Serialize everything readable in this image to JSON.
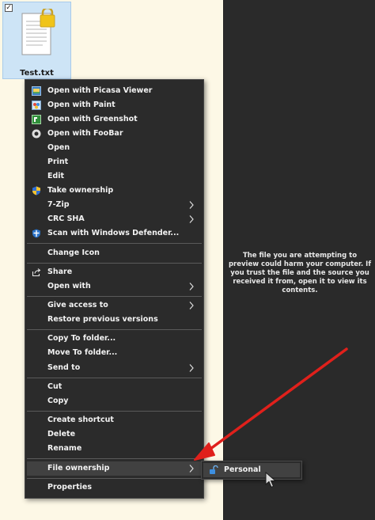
{
  "file": {
    "name": "Test.txt",
    "checked": true,
    "icon": "locked-text-file-icon"
  },
  "context_menu": {
    "items": [
      {
        "label": "Open with Picasa Viewer",
        "icon": "picasa-icon"
      },
      {
        "label": "Open with Paint",
        "icon": "paint-icon"
      },
      {
        "label": "Open with Greenshot",
        "icon": "greenshot-icon"
      },
      {
        "label": "Open with FooBar",
        "icon": "foobar-icon"
      },
      {
        "label": "Open",
        "default": true
      },
      {
        "label": "Print"
      },
      {
        "label": "Edit"
      },
      {
        "label": "Take ownership",
        "icon": "uac-shield-icon"
      },
      {
        "label": "7-Zip",
        "submenu": true
      },
      {
        "label": "CRC SHA",
        "submenu": true
      },
      {
        "label": "Scan with Windows Defender...",
        "icon": "defender-icon"
      },
      {
        "label": "Change Icon"
      },
      {
        "label": "Share",
        "icon": "share-icon"
      },
      {
        "label": "Open with",
        "submenu": true
      },
      {
        "label": "Give access to",
        "submenu": true
      },
      {
        "label": "Restore previous versions"
      },
      {
        "label": "Copy To folder..."
      },
      {
        "label": "Move To folder..."
      },
      {
        "label": "Send to",
        "submenu": true
      },
      {
        "label": "Cut"
      },
      {
        "label": "Copy"
      },
      {
        "label": "Create shortcut"
      },
      {
        "label": "Delete"
      },
      {
        "label": "Rename"
      },
      {
        "label": "File ownership",
        "submenu": true,
        "highlighted": true
      },
      {
        "label": "Properties"
      }
    ]
  },
  "submenu": {
    "items": [
      {
        "label": "Personal",
        "icon": "unlock-icon",
        "highlighted": true
      }
    ]
  },
  "preview": {
    "message": "The file you are attempting to preview could harm your computer. If you trust the file and the source you received it from, open it to view its contents."
  },
  "colors": {
    "menu_background": "#2b2b2b",
    "menu_highlight": "#414141",
    "menu_text": "#f2f2f2",
    "preview_background": "#2a2a2a",
    "desktop_background": "#fdf8e6",
    "selection_tile": "#cde4f6",
    "annotation_arrow": "#e0201b"
  }
}
